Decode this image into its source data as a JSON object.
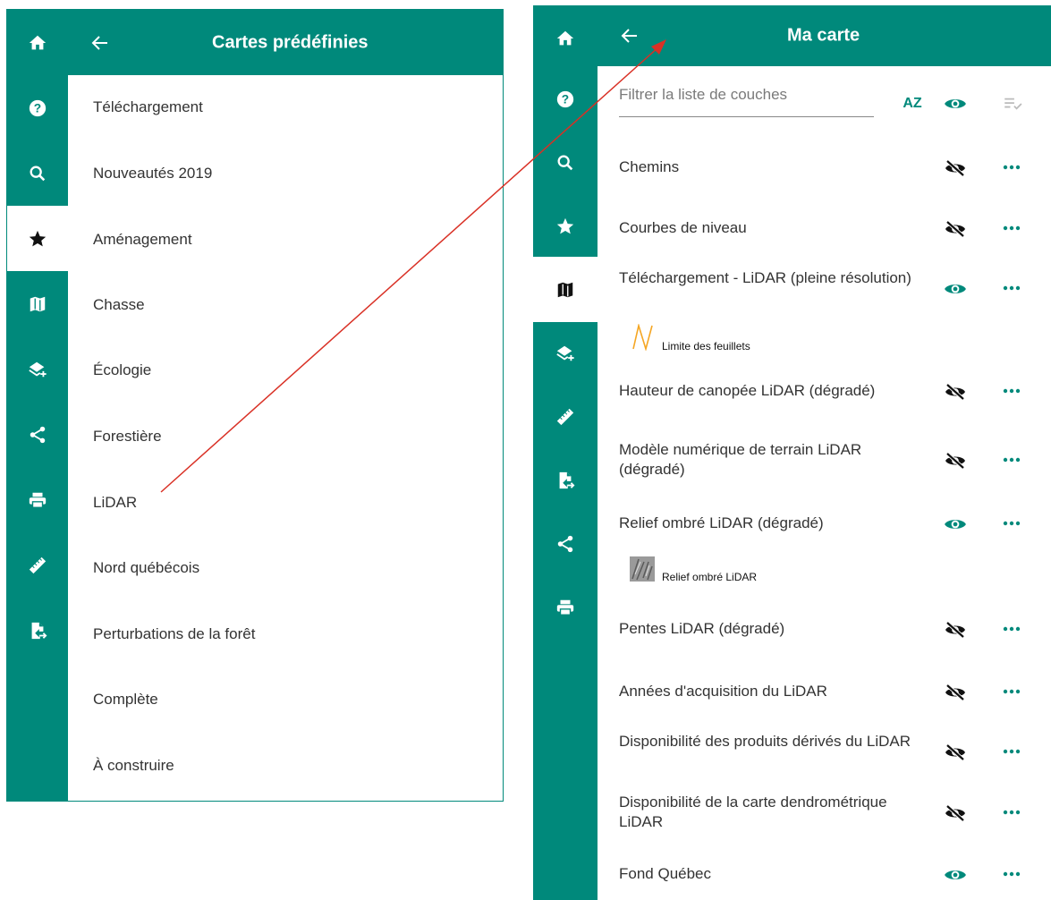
{
  "left_panel": {
    "title": "Cartes prédéfinies",
    "items": [
      "Téléchargement",
      "Nouveautés 2019",
      "Aménagement",
      "Chasse",
      "Écologie",
      "Forestière",
      "LiDAR",
      "Nord québécois",
      "Perturbations de la forêt",
      "Complète",
      "À construire"
    ]
  },
  "right_panel": {
    "title": "Ma carte",
    "filter_placeholder": "Filtrer la liste de couches",
    "sort_label": "AZ",
    "layers": [
      {
        "label": "Chemins",
        "visible": false
      },
      {
        "label": "Courbes de niveau",
        "visible": false
      },
      {
        "label": "Téléchargement - LiDAR (pleine résolution)",
        "visible": true
      },
      {
        "label": "Hauteur de canopée LiDAR (dégradé)",
        "visible": false
      },
      {
        "label": "Modèle numérique de terrain LiDAR (dégradé)",
        "visible": false
      },
      {
        "label": "Relief ombré LiDAR (dégradé)",
        "visible": true
      },
      {
        "label": "Pentes LiDAR (dégradé)",
        "visible": false
      },
      {
        "label": "Années d'acquisition du LiDAR",
        "visible": false
      },
      {
        "label": "Disponibilité des produits dérivés du LiDAR",
        "visible": false
      },
      {
        "label": "Disponibilité de la carte dendrométrique LiDAR",
        "visible": false
      },
      {
        "label": "Fond Québec",
        "visible": true
      }
    ],
    "legends": [
      {
        "label": "Limite des feuillets",
        "icon": "line-symbol-icon"
      },
      {
        "label": "Relief ombré LiDAR",
        "icon": "relief-thumbnail-icon"
      }
    ]
  },
  "colors": {
    "teal": "#00897b",
    "annotation": "#d93025",
    "legend_line": "#f5a623"
  },
  "icons": {
    "left_rail": [
      "home-icon",
      "help-icon",
      "search-icon",
      "star-icon",
      "map-icon",
      "add-layers-icon",
      "share-icon",
      "print-icon",
      "ruler-icon",
      "export-file-icon"
    ],
    "right_rail": [
      "home-icon",
      "help-icon",
      "search-icon",
      "star-icon",
      "map-icon",
      "add-layers-icon",
      "ruler-icon",
      "export-file-icon",
      "share-icon",
      "print-icon"
    ]
  }
}
